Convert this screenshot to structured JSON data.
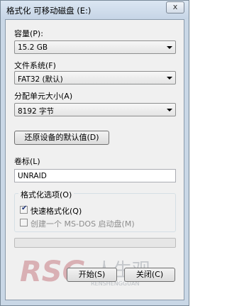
{
  "window": {
    "title": "格式化 可移动磁盘 (E:)",
    "close_glyph": "x"
  },
  "capacity": {
    "label": "容量(P):",
    "value": "15.2 GB"
  },
  "filesystem": {
    "label": "文件系统(F)",
    "value": "FAT32 (默认)"
  },
  "allocation": {
    "label": "分配单元大小(A)",
    "value": "8192 字节"
  },
  "restore_defaults_label": "还原设备的默认值(D)",
  "volume": {
    "label": "卷标(L)",
    "value": "UNRAID"
  },
  "options": {
    "title": "格式化选项(O)",
    "quick_format": {
      "label": "快速格式化(Q)",
      "checked": true
    },
    "ms_dos": {
      "label": "创建一个 MS-DOS 启动盘(M)",
      "checked": false
    }
  },
  "progress": {
    "value": 0
  },
  "watermark": {
    "brand": "RSG",
    "cn": "人生观",
    "en": "RENSHENGGUAN"
  },
  "buttons": {
    "start": "开始(S)",
    "close": "关闭(C)"
  }
}
